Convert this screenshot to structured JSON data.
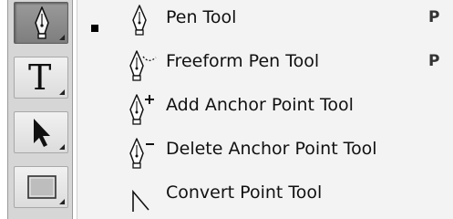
{
  "toolbar": {
    "tools": [
      {
        "name": "pen-tool",
        "active": true,
        "icon": "pen-nib-icon"
      },
      {
        "name": "type-tool",
        "active": false,
        "icon": "type-icon",
        "glyph": "T"
      },
      {
        "name": "path-selection-tool",
        "active": false,
        "icon": "arrow-cursor-icon"
      },
      {
        "name": "rectangle-tool",
        "active": false,
        "icon": "rectangle-icon"
      }
    ]
  },
  "menu": {
    "items": [
      {
        "label": "Pen Tool",
        "shortcut": "P",
        "selected": true,
        "icon": "pen-nib-icon"
      },
      {
        "label": "Freeform Pen Tool",
        "shortcut": "P",
        "selected": false,
        "icon": "freeform-pen-icon"
      },
      {
        "label": "Add Anchor Point Tool",
        "shortcut": "",
        "selected": false,
        "icon": "add-anchor-point-icon"
      },
      {
        "label": "Delete Anchor Point Tool",
        "shortcut": "",
        "selected": false,
        "icon": "delete-anchor-point-icon"
      },
      {
        "label": "Convert Point Tool",
        "shortcut": "",
        "selected": false,
        "icon": "convert-point-icon"
      }
    ]
  }
}
